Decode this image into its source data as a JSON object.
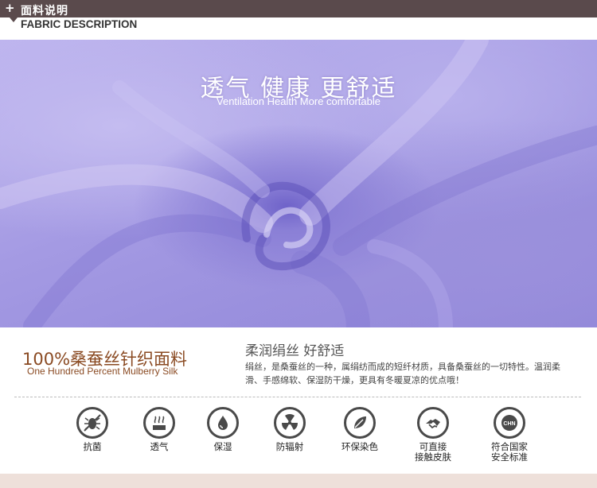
{
  "header": {
    "plus": "+",
    "title_cn": "面料说明",
    "title_en": "FABRIC DESCRIPTION"
  },
  "photo": {
    "headline_cn": "透气  健康  更舒适",
    "headline_en": "Ventilation  Health  More comfortable"
  },
  "product": {
    "name_cn": "100%桑蚕丝针织面料",
    "name_en": "One Hundred Percent Mulberry Silk"
  },
  "description": {
    "title": "柔润绢丝 好舒适",
    "body": "绢丝，是桑蚕丝的一种，属绢纺而成的短纤材质，具备桑蚕丝的一切特性。温润柔滑、手感绵软、保湿防干燥，更具有冬暖夏凉的优点哦！"
  },
  "features": [
    {
      "icon": "antibacterial-icon",
      "label": "抗菌"
    },
    {
      "icon": "breathable-icon",
      "label": "透气"
    },
    {
      "icon": "moisturize-icon",
      "label": "保湿"
    },
    {
      "icon": "radiation-icon",
      "label": "防辐射"
    },
    {
      "icon": "eco-dye-icon",
      "label": "环保染色"
    },
    {
      "icon": "skin-contact-icon",
      "label": "可直接\n接触皮肤"
    },
    {
      "icon": "chn-standard-icon",
      "label": "符合国家\n安全标准",
      "badge": "CHN"
    }
  ],
  "colors": {
    "header_bg": "#5a4a4c",
    "accent_brown": "#8a4a22",
    "fabric_lavender": "#a49ae3"
  }
}
